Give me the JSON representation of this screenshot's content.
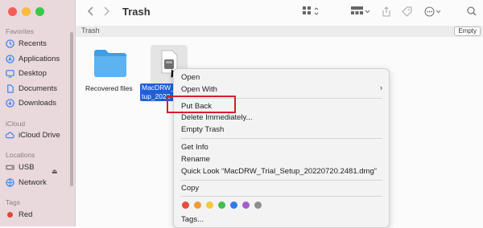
{
  "window": {
    "title": "Trash"
  },
  "sidebar": {
    "favorites_title": "Favorites",
    "favorites": [
      {
        "label": "Recents",
        "icon": "clock-icon"
      },
      {
        "label": "Applications",
        "icon": "applications-icon"
      },
      {
        "label": "Desktop",
        "icon": "desktop-icon"
      },
      {
        "label": "Documents",
        "icon": "document-icon"
      },
      {
        "label": "Downloads",
        "icon": "download-icon"
      }
    ],
    "icloud_title": "iCloud",
    "icloud": [
      {
        "label": "iCloud Drive",
        "icon": "cloud-icon"
      }
    ],
    "locations_title": "Locations",
    "locations": [
      {
        "label": "USB",
        "icon": "drive-icon"
      },
      {
        "label": "Network",
        "icon": "network-icon"
      }
    ],
    "tags_title": "Tags",
    "tags": [
      {
        "label": "Red",
        "color": "#e0463c"
      }
    ]
  },
  "pathbar": {
    "crumb": "Trash",
    "empty_button": "Empty"
  },
  "files": [
    {
      "name": "Recovered files",
      "icon": "folder-icon"
    },
    {
      "name": "MacDRW_\ntup_2022",
      "icon": "dmg-icon",
      "selected": true
    }
  ],
  "context_menu": {
    "items": [
      {
        "label": "Open"
      },
      {
        "label": "Open With",
        "submenu": true
      },
      {
        "label": "Put Back",
        "highlighted": true
      },
      {
        "label": "Delete Immediately..."
      },
      {
        "label": "Empty Trash"
      },
      {
        "label": "Get Info"
      },
      {
        "label": "Rename"
      },
      {
        "label": "Quick Look “MacDRW_Trial_Setup_20220720.2481.dmg”"
      },
      {
        "label": "Copy"
      },
      {
        "label": "Tags..."
      }
    ],
    "tag_colors": [
      "#e84b3c",
      "#f29a38",
      "#f3c93a",
      "#3fbf4f",
      "#2f7bf5",
      "#a35ed2",
      "#8e8e8e"
    ]
  },
  "colors": {
    "accent": "#2f7bf5",
    "selection": "#1f5fd8",
    "highlight_box": "#d0202a"
  }
}
